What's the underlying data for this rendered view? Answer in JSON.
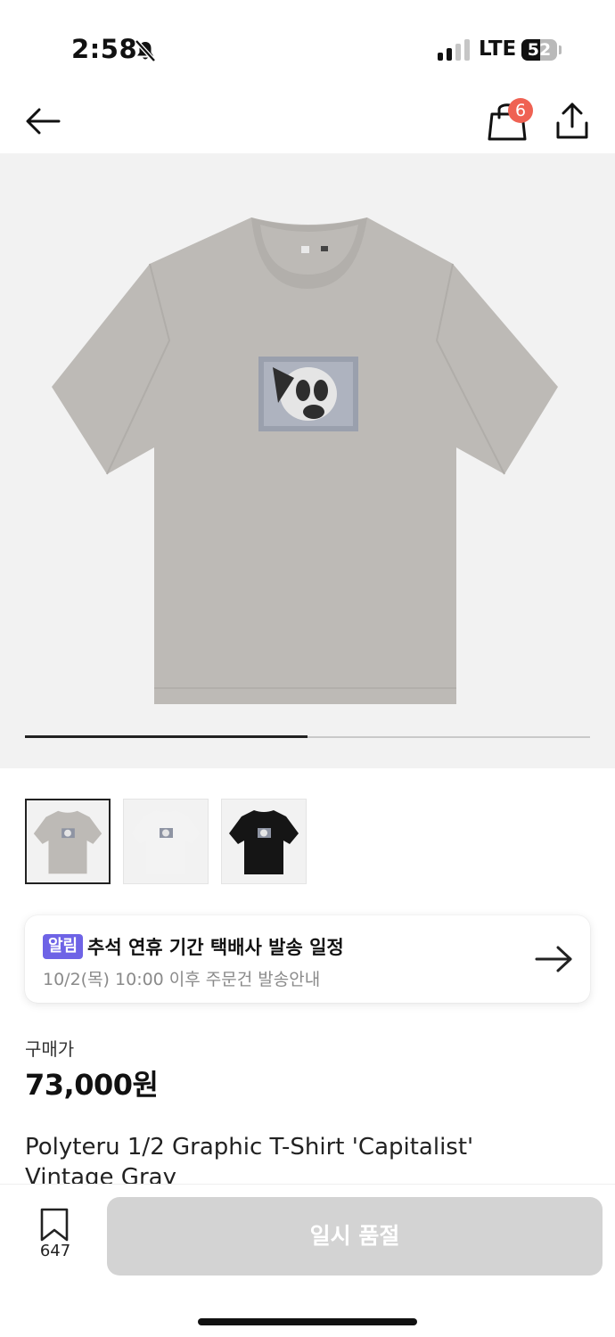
{
  "status_bar": {
    "time": "2:58",
    "network": "LTE",
    "battery": "52",
    "battery_level": 0.52
  },
  "header": {
    "cart_badge_count": "6"
  },
  "gallery": {
    "progress": 0.5,
    "thumbnails": [
      {
        "label": "gray",
        "shirt_color": "#bdbab6"
      },
      {
        "label": "white",
        "shirt_color": "#f3f3f3"
      },
      {
        "label": "black",
        "shirt_color": "#151515"
      }
    ],
    "selected_index": 0
  },
  "notice": {
    "badge": "알림",
    "title": "추석 연휴 기간 택배사 발송 일정",
    "subtitle": "10/2(목) 10:00 이후 주문건 발송안내"
  },
  "price": {
    "label": "구매가",
    "value": "73,000원"
  },
  "product": {
    "title": "Polyteru 1/2 Graphic T-Shirt 'Capitalist' Vintage Gray"
  },
  "bottom_bar": {
    "wish_count": "647",
    "purchase_button_label": "일시 품절"
  },
  "colors": {
    "badge_red": "#ef6253",
    "notice_purple": "#6e63e6",
    "disabled_button": "#d3d3d3",
    "image_background": "#f2f2f2"
  }
}
